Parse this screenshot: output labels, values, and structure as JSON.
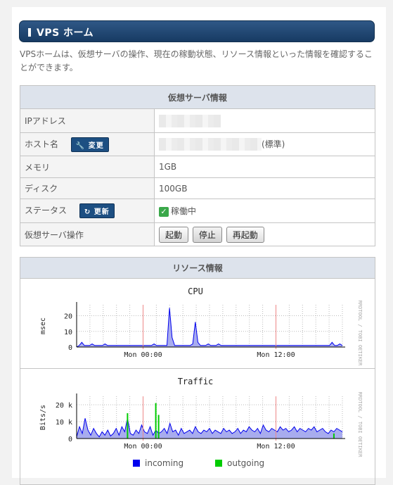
{
  "header": {
    "title": "VPS ホーム"
  },
  "intro": "VPSホームは、仮想サーバの操作、現在の稼動状態、リソース情報といった情報を確認することができます。",
  "server_info": {
    "title": "仮想サーバ情報",
    "rows": {
      "ip": {
        "label": "IPアドレス"
      },
      "host": {
        "label": "ホスト名",
        "button": "変更",
        "suffix": "(標準)"
      },
      "memory": {
        "label": "メモリ",
        "value": "1GB"
      },
      "disk": {
        "label": "ディスク",
        "value": "100GB"
      },
      "status": {
        "label": "ステータス",
        "button": "更新",
        "value": "稼働中"
      },
      "ops": {
        "label": "仮想サーバ操作",
        "start": "起動",
        "stop": "停止",
        "restart": "再起動"
      }
    }
  },
  "resources": {
    "title": "リソース情報",
    "credit": "RRDTOOL / TOBI OETIKER"
  },
  "chart_data": [
    {
      "type": "area",
      "title": "CPU",
      "ylabel": "msec",
      "xticks": [
        "Mon 00:00",
        "Mon 12:00"
      ],
      "yticks": [
        "0",
        "10",
        "20"
      ],
      "ylim": [
        0,
        27
      ],
      "series": [
        {
          "color": "#0000ee",
          "values": [
            0,
            1,
            3,
            1,
            1,
            1,
            2,
            1,
            1,
            1,
            1,
            2,
            1,
            1,
            1,
            1,
            1,
            1,
            1,
            1,
            1,
            1,
            1,
            1,
            1,
            1,
            1,
            1,
            1,
            1,
            2,
            1,
            1,
            1,
            1,
            1,
            25,
            6,
            1,
            1,
            1,
            1,
            1,
            1,
            1,
            2,
            16,
            3,
            1,
            1,
            1,
            2,
            1,
            1,
            1,
            2,
            1,
            1,
            1,
            1,
            1,
            1,
            1,
            1,
            1,
            1,
            1,
            1,
            1,
            1,
            1,
            1,
            1,
            1,
            1,
            1,
            1,
            1,
            1,
            1,
            1,
            1,
            1,
            1,
            1,
            1,
            1,
            1,
            1,
            1,
            1,
            1,
            1,
            1,
            1,
            1,
            1,
            1,
            1,
            3,
            1,
            1,
            2,
            1
          ]
        }
      ]
    },
    {
      "type": "area",
      "title": "Traffic",
      "ylabel": "Bits/s",
      "xticks": [
        "Mon 00:00",
        "Mon 12:00"
      ],
      "yticks": [
        "0",
        "10 k",
        "20 k"
      ],
      "ylim": [
        0,
        25000
      ],
      "legend": [
        {
          "name": "incoming",
          "color": "#0000ee"
        },
        {
          "name": "outgoing",
          "color": "#00cc00"
        }
      ],
      "series": [
        {
          "name": "incoming",
          "color": "#0000ee",
          "values": [
            1000,
            7000,
            3000,
            12000,
            5000,
            2000,
            6000,
            3000,
            1000,
            4000,
            2000,
            5000,
            1500,
            3000,
            6000,
            2000,
            7000,
            4000,
            12000,
            3000,
            2000,
            5000,
            3000,
            8000,
            4000,
            3000,
            7000,
            2000,
            5000,
            3000,
            4000,
            6000,
            3000,
            9000,
            4000,
            5000,
            2000,
            6000,
            3000,
            4000,
            5000,
            3000,
            7000,
            4000,
            3000,
            5000,
            4000,
            6000,
            3000,
            5000,
            4000,
            3000,
            6000,
            4000,
            5000,
            3000,
            4000,
            6000,
            3000,
            5000,
            4000,
            7000,
            5000,
            4000,
            6000,
            3000,
            8000,
            5000,
            4000,
            6000,
            5000,
            4000,
            7000,
            5000,
            6000,
            4000,
            5000,
            7000,
            4000,
            6000,
            5000,
            4000,
            6000,
            5000,
            7000,
            4000,
            5000,
            6000,
            4000,
            3000,
            5000,
            4000,
            6000,
            5000,
            4000
          ]
        },
        {
          "name": "outgoing",
          "color": "#00cc00",
          "values": [
            0,
            0,
            0,
            0,
            0,
            0,
            0,
            0,
            0,
            0,
            0,
            0,
            0,
            0,
            0,
            0,
            0,
            0,
            15000,
            0,
            0,
            0,
            0,
            0,
            0,
            0,
            0,
            0,
            21000,
            14000,
            0,
            0,
            0,
            0,
            0,
            0,
            0,
            0,
            0,
            0,
            0,
            0,
            0,
            0,
            0,
            0,
            0,
            0,
            0,
            0,
            0,
            0,
            0,
            0,
            0,
            0,
            0,
            0,
            0,
            0,
            0,
            0,
            0,
            0,
            0,
            0,
            0,
            0,
            0,
            0,
            0,
            0,
            0,
            0,
            0,
            0,
            0,
            0,
            0,
            0,
            0,
            0,
            0,
            0,
            0,
            0,
            0,
            0,
            0,
            0,
            0,
            3000,
            0,
            0,
            0
          ]
        }
      ]
    }
  ]
}
